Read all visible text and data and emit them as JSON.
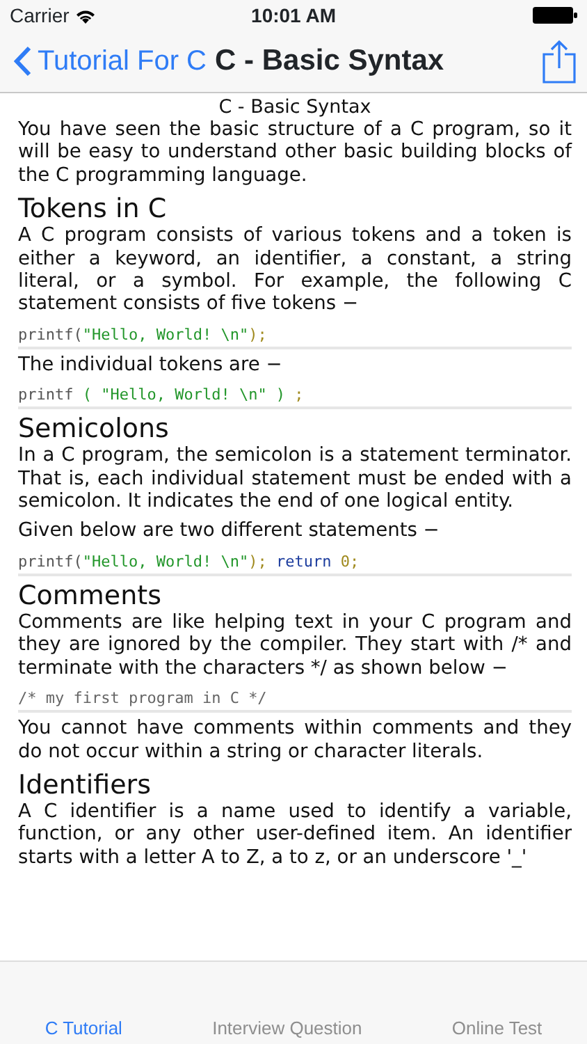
{
  "status_bar": {
    "carrier": "Carrier",
    "time": "10:01 AM"
  },
  "nav_bar": {
    "back": "Tutorial For C",
    "title": "C - Basic Syntax"
  },
  "content": [
    {
      "kind": "caption",
      "text": "C - Basic Syntax"
    },
    {
      "kind": "paragraph",
      "text": "You have seen the basic structure of a C program, so it will be easy to understand other basic building blocks of the C programming language."
    },
    {
      "kind": "heading",
      "text": "Tokens in C"
    },
    {
      "kind": "paragraph",
      "text": "A C program consists of various tokens and a token is either a keyword, an identifier, a constant, a string literal, or a symbol. For example, the following C statement consists of five tokens −"
    },
    {
      "kind": "code",
      "tokens": [
        {
          "kind": "plain",
          "text": "printf("
        },
        {
          "kind": "string",
          "text": "\"Hello, World! \\n\""
        },
        {
          "kind": "punct",
          "text": ");"
        }
      ]
    },
    {
      "kind": "paragraph",
      "text": "The individual tokens are −"
    },
    {
      "kind": "code",
      "tokens": [
        {
          "kind": "plain",
          "text": "printf "
        },
        {
          "kind": "string",
          "text": "( \"Hello, World! \\n\" )"
        },
        {
          "kind": "punct",
          "text": " ;"
        }
      ]
    },
    {
      "kind": "heading",
      "text": "Semicolons"
    },
    {
      "kind": "paragraph",
      "text": "In a C program, the semicolon is a statement terminator. That is, each individual statement must be ended with a semicolon. It indicates the end of one logical entity."
    },
    {
      "kind": "paragraph",
      "text": "Given below are two different statements −"
    },
    {
      "kind": "code",
      "tokens": [
        {
          "kind": "plain",
          "text": "printf("
        },
        {
          "kind": "string",
          "text": "\"Hello, World! \\n\""
        },
        {
          "kind": "punct",
          "text": "); "
        },
        {
          "kind": "keyword",
          "text": "return"
        },
        {
          "kind": "punct",
          "text": " 0;"
        }
      ]
    },
    {
      "kind": "heading",
      "text": "Comments"
    },
    {
      "kind": "paragraph",
      "text": "Comments are like helping text in your C program and they are ignored by the compiler. They start with /* and terminate with the characters */ as shown below −"
    },
    {
      "kind": "code",
      "tokens": [
        {
          "kind": "comment",
          "text": "/* my first program in C */"
        }
      ]
    },
    {
      "kind": "paragraph",
      "text": "You cannot have comments within comments and they do not occur within a string or character literals."
    },
    {
      "kind": "heading",
      "text": "Identifiers"
    },
    {
      "kind": "paragraph",
      "text": "A C identifier is a name used to identify a variable, function, or any other user-defined item. An identifier starts with a letter A to Z, a to z, or an underscore '_'"
    }
  ],
  "tabs": [
    {
      "label": "C Tutorial",
      "selected": true
    },
    {
      "label": "Interview Question",
      "selected": false
    },
    {
      "label": "Online Test",
      "selected": false
    }
  ]
}
